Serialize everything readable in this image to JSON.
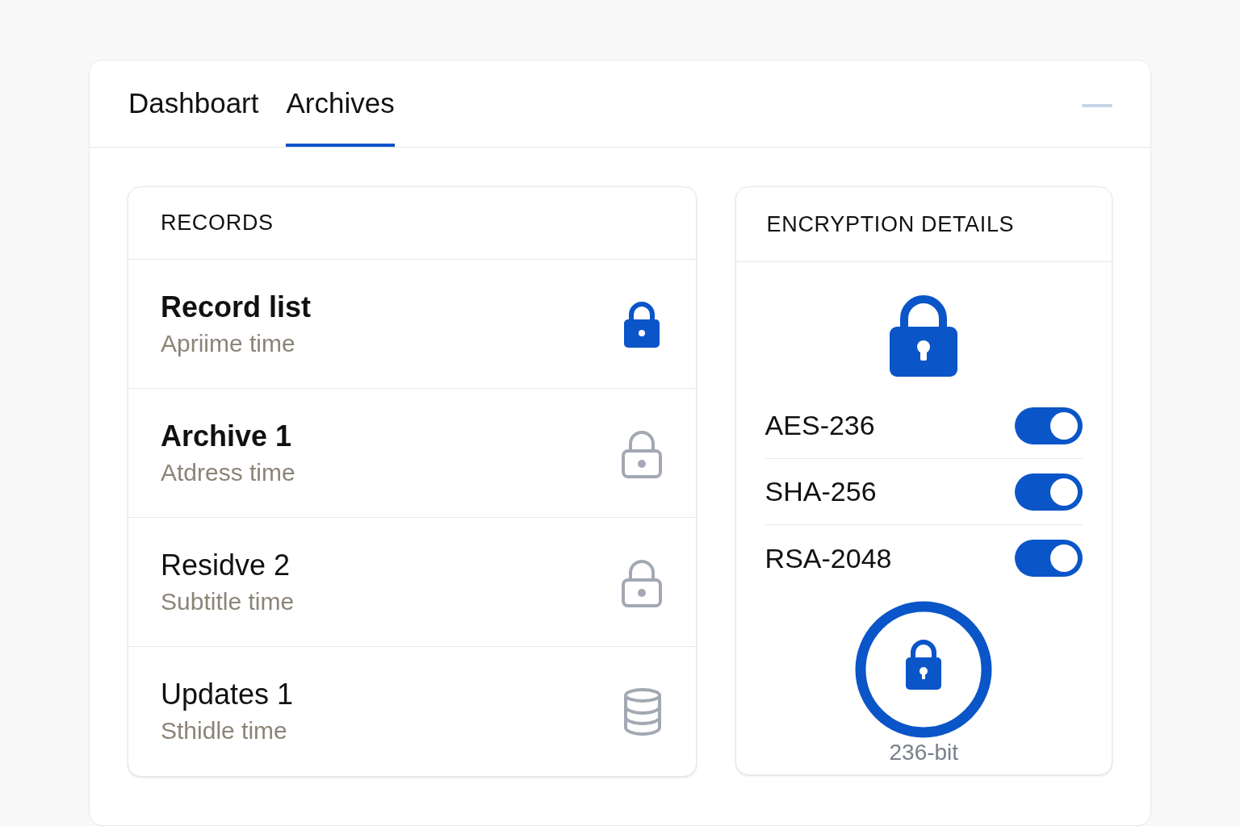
{
  "tabs": [
    {
      "label": "Dashboart",
      "selected": false
    },
    {
      "label": "Archives",
      "selected": true
    }
  ],
  "records": {
    "title": "RECORDS",
    "items": [
      {
        "title": "Record list",
        "subtitle": "Apriime time",
        "kind": "lock",
        "locked": true
      },
      {
        "title": "Archive 1",
        "subtitle": "Atdress time",
        "kind": "lock",
        "locked": false
      },
      {
        "title": "Residve 2",
        "subtitle": "Subtitle time",
        "kind": "lock",
        "locked": false
      },
      {
        "title": "Updates 1",
        "subtitle": "Sthidle time",
        "kind": "database"
      }
    ]
  },
  "encryption": {
    "title": "ENCRYPTION DETAILS",
    "algorithms": [
      {
        "label": "AES-236",
        "on": true
      },
      {
        "label": "SHA-256",
        "on": true
      },
      {
        "label": "RSA-2048",
        "on": true
      }
    ],
    "key_size": "236-bit"
  }
}
